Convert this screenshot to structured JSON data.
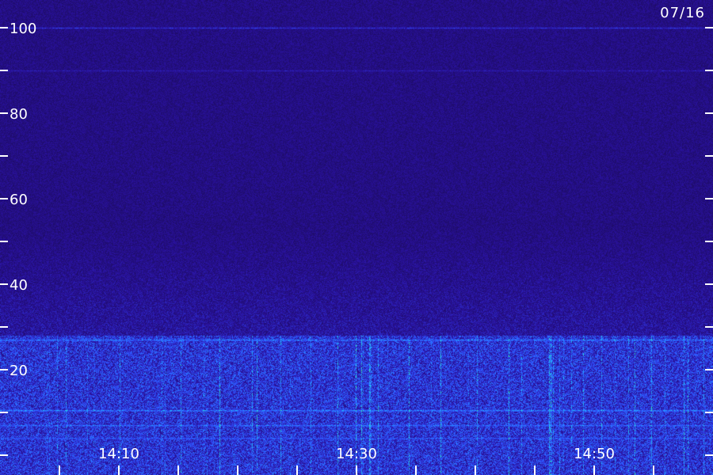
{
  "chart_data": {
    "type": "heatmap",
    "title": "",
    "date": "07/16",
    "xlabel": "",
    "ylabel": "",
    "ylim": [
      0,
      100
    ],
    "y_major_ticks": [
      20,
      40,
      60,
      80,
      100
    ],
    "y_minor_ticks": [
      0,
      10,
      30,
      50,
      70,
      90
    ],
    "y_tick_labels": [
      "20",
      "40",
      "60",
      "80",
      "100"
    ],
    "xlim": [
      "14:00",
      "15:00"
    ],
    "x_tick_minutes": [
      0,
      5,
      10,
      15,
      20,
      25,
      30,
      35,
      40,
      45,
      50,
      55
    ],
    "x_tick_labels": [
      {
        "label": "14:10",
        "minute": 10
      },
      {
        "label": "14:30",
        "minute": 30
      },
      {
        "label": "14:50",
        "minute": 50
      }
    ],
    "colormap": [
      "#1a0a55",
      "#2a12a0",
      "#3050ff",
      "#20c0ff",
      "#40ff90"
    ],
    "background_intensity": 0.18,
    "bands": [
      {
        "y": 100,
        "intensity": 0.45
      },
      {
        "y": 90,
        "intensity": 0.35
      },
      {
        "y": 27,
        "intensity": 0.75
      },
      {
        "y": 10.5,
        "intensity": 0.8
      },
      {
        "y": 7,
        "intensity": 0.7
      },
      {
        "y": 4,
        "intensity": 0.65
      }
    ],
    "noise_floor_region": {
      "y_from": 0,
      "y_to": 28,
      "intensity": 0.45
    },
    "mid_region": {
      "y_from": 28,
      "y_to": 55,
      "intensity": 0.28
    }
  }
}
